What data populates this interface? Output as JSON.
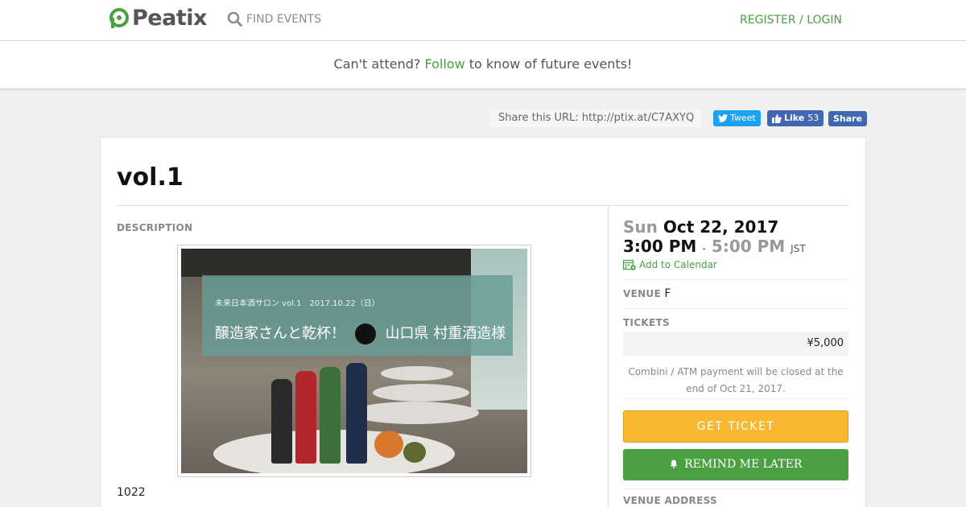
{
  "nav": {
    "logo_text": "Peatix",
    "find_events": "FIND EVENTS",
    "register_login": "REGISTER / LOGIN"
  },
  "banner": {
    "prefix": "Can't attend?",
    "link": "Follow",
    "suffix": "to know of future events!"
  },
  "share": {
    "url_text": "Share this URL: http://ptix.at/C7AXYQ",
    "tweet": "Tweet",
    "like": "Like",
    "like_count": "53",
    "share": "Share"
  },
  "event": {
    "title": "vol.1",
    "description_label": "DESCRIPTION",
    "image_overlay_small": "未来日本酒サロン vol.1　2017.10.22（日）",
    "image_overlay_left": "醸造家さんと乾杯！",
    "image_overlay_right": "山口県 村重酒造様",
    "description_text": "1022"
  },
  "details": {
    "day_of_week": "Sun",
    "date": "Oct 22, 2017",
    "start_time": "3:00 PM",
    "dash": "-",
    "end_time": "5:00 PM",
    "timezone": "JST",
    "add_calendar": "Add to Calendar",
    "venue_label": "VENUE",
    "venue_value": "F",
    "tickets_label": "TICKETS",
    "price": "¥5,000",
    "notice": "Combini / ATM payment will be closed at the end of Oct 21, 2017.",
    "get_ticket": "GET TICKET",
    "remind_me": "REMIND ME LATER",
    "venue_address_label": "VENUE ADDRESS"
  },
  "colors": {
    "brand_green": "#4aa043",
    "ticket_yellow": "#f7b731",
    "twitter_blue": "#1da1f2",
    "facebook_blue": "#4267b2"
  }
}
